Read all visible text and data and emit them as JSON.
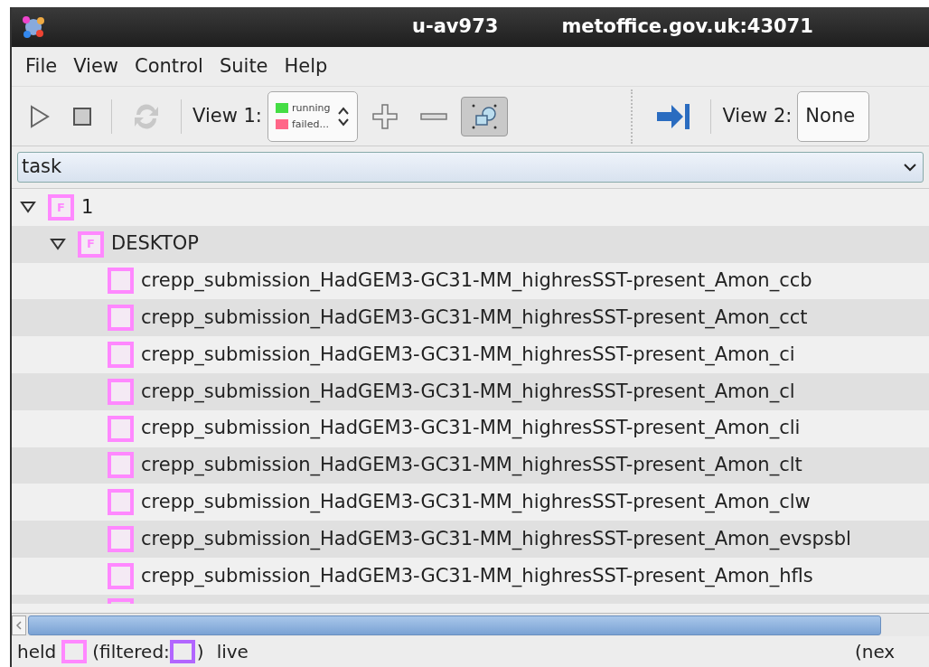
{
  "window": {
    "title": "u-av973",
    "host": "metoffice.gov.uk:43071"
  },
  "menu": [
    "File",
    "View",
    "Control",
    "Suite",
    "Help"
  ],
  "toolbar": {
    "view1_label": "View 1:",
    "legend": [
      {
        "label": "running",
        "color": "#44dd44"
      },
      {
        "label": "failed...",
        "color": "#ff6688"
      }
    ],
    "filter_toggle": {
      "selected": true
    },
    "refresh": {
      "disabled": true
    },
    "view2_label": "View 2:",
    "view2_value": "None"
  },
  "filter_combo": {
    "value": "task"
  },
  "tree": [
    {
      "name": "1",
      "icon_letter": "F",
      "expanded": true,
      "children": [
        {
          "name": "DESKTOP",
          "icon_letter": "F",
          "expanded": true,
          "children": [
            {
              "name": "crepp_submission_HadGEM3-GC31-MM_highresSST-present_Amon_ccb"
            },
            {
              "name": "crepp_submission_HadGEM3-GC31-MM_highresSST-present_Amon_cct"
            },
            {
              "name": "crepp_submission_HadGEM3-GC31-MM_highresSST-present_Amon_ci"
            },
            {
              "name": "crepp_submission_HadGEM3-GC31-MM_highresSST-present_Amon_cl"
            },
            {
              "name": "crepp_submission_HadGEM3-GC31-MM_highresSST-present_Amon_cli"
            },
            {
              "name": "crepp_submission_HadGEM3-GC31-MM_highresSST-present_Amon_clt"
            },
            {
              "name": "crepp_submission_HadGEM3-GC31-MM_highresSST-present_Amon_clw"
            },
            {
              "name": "crepp_submission_HadGEM3-GC31-MM_highresSST-present_Amon_evspsbl"
            },
            {
              "name": "crepp_submission_HadGEM3-GC31-MM_highresSST-present_Amon_hfls"
            }
          ]
        }
      ]
    }
  ],
  "status_bar": {
    "held": "held",
    "filtered": "(filtered:",
    "close_paren": ")",
    "live": "live",
    "right": "(nex"
  }
}
